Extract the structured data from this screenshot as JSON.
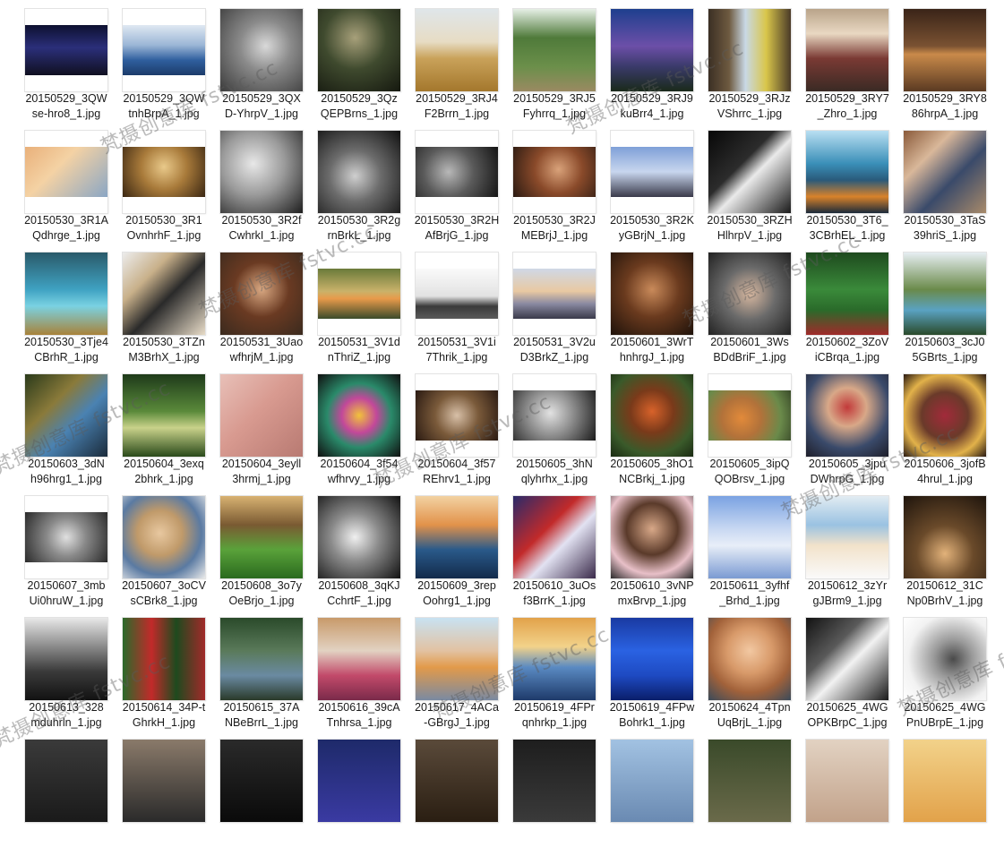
{
  "files": [
    {
      "name_line1": "20150529_3QW",
      "name_line2": "se-hro8_1.jpg",
      "thumb": {
        "fit": "landscape",
        "bg": "linear-gradient(180deg,#0d1030 0%,#2b2f7a 45%,#101020 100%)"
      }
    },
    {
      "name_line1": "20150529_3QW",
      "name_line2": "tnhBrpA_1.jpg",
      "thumb": {
        "fit": "landscape",
        "bg": "linear-gradient(180deg,#dfe8f2 0%,#9bb6d6 40%,#2f5f9e 70%,#1c3b6a 100%)"
      }
    },
    {
      "name_line1": "20150529_3QX",
      "name_line2": "D-YhrpV_1.jpg",
      "thumb": {
        "fit": "square",
        "bg": "radial-gradient(circle at 55% 45%,#d9d9d9 0%,#8a8a8a 40%,#3b3b3b 100%)"
      }
    },
    {
      "name_line1": "20150529_3Qz",
      "name_line2": "QEPBrns_1.jpg",
      "thumb": {
        "fit": "square",
        "bg": "radial-gradient(circle at 45% 35%,#a7a07a 0%,#3f4a2e 45%,#15180f 100%)"
      }
    },
    {
      "name_line1": "20150529_3RJ4",
      "name_line2": "F2Brrn_1.jpg",
      "thumb": {
        "fit": "square",
        "bg": "linear-gradient(180deg,#dfe6ea 0%,#e7dcc4 40%,#c9a25a 60%,#a4772c 100%)"
      }
    },
    {
      "name_line1": "20150529_3RJ5",
      "name_line2": "Fyhrrq_1.jpg",
      "thumb": {
        "fit": "square",
        "bg": "linear-gradient(180deg,#e6efe6 0%,#4f7a3a 35%,#6b8f4a 70%,#9a8a62 100%)"
      }
    },
    {
      "name_line1": "20150529_3RJ9",
      "name_line2": "kuBrr4_1.jpg",
      "thumb": {
        "fit": "square",
        "bg": "linear-gradient(180deg,#1e3f8e 0%,#6c4fa8 45%,#3a3a6a 70%,#1a2a1a 100%)"
      }
    },
    {
      "name_line1": "20150529_3RJz",
      "name_line2": "VShrrc_1.jpg",
      "thumb": {
        "fit": "square",
        "bg": "linear-gradient(90deg,#3b2f24 0%,#6e5a40 25%,#c9d9e6 45%,#d9c64a 70%,#4a3a28 100%)"
      }
    },
    {
      "name_line1": "20150529_3RY7",
      "name_line2": "_Zhro_1.jpg",
      "thumb": {
        "fit": "square",
        "bg": "linear-gradient(180deg,#b9a48a 0%,#e9d8c2 30%,#7a3a34 60%,#3a2a24 100%)"
      }
    },
    {
      "name_line1": "20150529_3RY8",
      "name_line2": "86hrpA_1.jpg",
      "thumb": {
        "fit": "square",
        "bg": "linear-gradient(180deg,#3a2418 0%,#7a5232 45%,#c98a4a 55%,#5a3a22 100%)"
      }
    },
    {
      "name_line1": "20150530_3R1A",
      "name_line2": "Qdhrge_1.jpg",
      "thumb": {
        "fit": "landscape",
        "bg": "linear-gradient(135deg,#e9b07a 0%,#f4d2a4 40%,#8aa6c4 100%)"
      }
    },
    {
      "name_line1": "20150530_3R1",
      "name_line2": "OvnhrhF_1.jpg",
      "thumb": {
        "fit": "landscape",
        "bg": "radial-gradient(circle at 50% 40%,#e9c98a 0%,#a87a3a 45%,#3a2612 100%)"
      }
    },
    {
      "name_line1": "20150530_3R2f",
      "name_line2": "CwhrkI_1.jpg",
      "thumb": {
        "fit": "square",
        "bg": "radial-gradient(circle at 40% 40%,#e8e8e8 0%,#9a9a9a 45%,#1e1e1e 100%)"
      }
    },
    {
      "name_line1": "20150530_3R2g",
      "name_line2": "rnBrkL_1.jpg",
      "thumb": {
        "fit": "square",
        "bg": "radial-gradient(circle at 45% 55%,#cfcfcf 0%,#6c6c6c 40%,#101010 100%)"
      }
    },
    {
      "name_line1": "20150530_3R2H",
      "name_line2": "AfBrjG_1.jpg",
      "thumb": {
        "fit": "landscape",
        "bg": "radial-gradient(circle at 40% 50%,#b8b8b8 0%,#5a5a5a 45%,#141414 100%)"
      }
    },
    {
      "name_line1": "20150530_3R2J",
      "name_line2": "MEBrjJ_1.jpg",
      "thumb": {
        "fit": "landscape",
        "bg": "radial-gradient(circle at 55% 45%,#d9a27a 0%,#8a4a2a 45%,#2a1a12 100%)"
      }
    },
    {
      "name_line1": "20150530_3R2K",
      "name_line2": "yGBrjN_1.jpg",
      "thumb": {
        "fit": "landscape",
        "bg": "linear-gradient(180deg,#7fa0d8 0%,#c8d6ee 50%,#3a3a4a 100%)"
      }
    },
    {
      "name_line1": "20150530_3RZH",
      "name_line2": "HlhrpV_1.jpg",
      "thumb": {
        "fit": "square",
        "bg": "linear-gradient(135deg,#080808 0%,#2c2c2c 40%,#eaeaea 55%,#1a1a1a 100%)"
      }
    },
    {
      "name_line1": "20150530_3T6_",
      "name_line2": "3CBrhEL_1.jpg",
      "thumb": {
        "fit": "square",
        "bg": "linear-gradient(180deg,#b9dff2 0%,#3a8fb8 40%,#2a5a7a 60%,#d8822a 80%,#1a2a3a 100%)"
      }
    },
    {
      "name_line1": "20150530_3TaS",
      "name_line2": "39hriS_1.jpg",
      "thumb": {
        "fit": "square",
        "bg": "linear-gradient(135deg,#8a5a3a 0%,#d9b89a 30%,#3a4a6a 60%,#a88a6a 100%)"
      }
    },
    {
      "name_line1": "20150530_3Tje4",
      "name_line2": "CBrhR_1.jpg",
      "thumb": {
        "fit": "square",
        "bg": "linear-gradient(180deg,#2a5a6a 0%,#3fa2c2 45%,#7ad2e2 65%,#a8823a 100%)"
      }
    },
    {
      "name_line1": "20150530_3TZn",
      "name_line2": "M3BrhX_1.jpg",
      "thumb": {
        "fit": "square",
        "bg": "linear-gradient(135deg,#ececec 0%,#c8b08a 30%,#2a2a2a 55%,#e8dcc8 100%)"
      }
    },
    {
      "name_line1": "20150531_3Uao",
      "name_line2": "wfhrjM_1.jpg",
      "thumb": {
        "fit": "square",
        "bg": "radial-gradient(circle at 50% 45%,#d9a882 0%,#6a3a22 45%,#3a2a1e 100%)"
      }
    },
    {
      "name_line1": "20150531_3V1d",
      "name_line2": "nThriZ_1.jpg",
      "thumb": {
        "fit": "landscape",
        "bg": "linear-gradient(180deg,#6a7a3a 0%,#c9b26a 45%,#e89a4a 60%,#3a4a2a 100%)"
      }
    },
    {
      "name_line1": "20150531_3V1i",
      "name_line2": "7Thrik_1.jpg",
      "thumb": {
        "fit": "landscape",
        "bg": "linear-gradient(180deg,#fafafa 0%,#e2e2e2 55%,#3a3a3a 75%,#5a5a5a 100%)"
      }
    },
    {
      "name_line1": "20150531_3V2u",
      "name_line2": "D3BrkZ_1.jpg",
      "thumb": {
        "fit": "landscape",
        "bg": "linear-gradient(180deg,#cfd8e6 0%,#e9c9a2 45%,#8a8aa2 70%,#3a3a4a 100%)"
      }
    },
    {
      "name_line1": "20150601_3WrT",
      "name_line2": "hnhrgJ_1.jpg",
      "thumb": {
        "fit": "square",
        "bg": "radial-gradient(circle at 50% 45%,#c98a5a 0%,#6a3a1e 45%,#1e120a 100%)"
      }
    },
    {
      "name_line1": "20150601_3Ws",
      "name_line2": "BDdBriF_1.jpg",
      "thumb": {
        "fit": "square",
        "bg": "radial-gradient(circle at 50% 50%,#d8b8a0 0%,#6a6a6a 45%,#222 100%)"
      }
    },
    {
      "name_line1": "20150602_3ZoV",
      "name_line2": "iCBrqa_1.jpg",
      "thumb": {
        "fit": "square",
        "bg": "linear-gradient(180deg,#1e4a1e 0%,#3a8a3a 45%,#2a6a2a 70%,#a02a2a 100%)"
      }
    },
    {
      "name_line1": "20150603_3cJ0",
      "name_line2": "5GBrts_1.jpg",
      "thumb": {
        "fit": "square",
        "bg": "linear-gradient(180deg,#e6eef2 0%,#6a8a4a 45%,#5aa2c2 70%,#2a4a2a 100%)"
      }
    },
    {
      "name_line1": "20150603_3dN",
      "name_line2": "h96hrg1_1.jpg",
      "thumb": {
        "fit": "square",
        "bg": "linear-gradient(135deg,#2a3a1a 0%,#8a7a3a 35%,#4a82b2 60%,#1a2a3a 100%)"
      }
    },
    {
      "name_line1": "20150604_3exq",
      "name_line2": "2bhrk_1.jpg",
      "thumb": {
        "fit": "square",
        "bg": "linear-gradient(180deg,#1e3a1a 0%,#5a8a3a 45%,#c9d28a 65%,#2a4a1a 100%)"
      }
    },
    {
      "name_line1": "20150604_3eyll",
      "name_line2": "3hrmj_1.jpg",
      "thumb": {
        "fit": "square",
        "bg": "linear-gradient(135deg,#e8c0b8 0%,#d89a90 45%,#b87a72 100%)"
      }
    },
    {
      "name_line1": "20150604_3f54",
      "name_line2": "wfhrvy_1.jpg",
      "thumb": {
        "fit": "square",
        "bg": "radial-gradient(circle at 50% 50%,#f2c23a 0%,#c2489a 30%,#2a8a6a 55%,#101010 100%)"
      }
    },
    {
      "name_line1": "20150604_3f57",
      "name_line2": "REhrv1_1.jpg",
      "thumb": {
        "fit": "landscape",
        "bg": "radial-gradient(circle at 50% 50%,#d8c0a8 0%,#7a5a3a 45%,#2a1a12 100%)"
      }
    },
    {
      "name_line1": "20150605_3hN",
      "name_line2": "qlyhrhx_1.jpg",
      "thumb": {
        "fit": "landscape",
        "bg": "radial-gradient(circle at 45% 45%,#e2e2e2 0%,#8a8a8a 45%,#1a1a1a 100%)"
      }
    },
    {
      "name_line1": "20150605_3hO1",
      "name_line2": "NCBrkj_1.jpg",
      "thumb": {
        "fit": "square",
        "bg": "radial-gradient(circle at 50% 45%,#d8622a 0%,#7a3a1a 35%,#3a5a2a 70%,#1a2a12 100%)"
      }
    },
    {
      "name_line1": "20150605_3ipQ",
      "name_line2": "QOBrsv_1.jpg",
      "thumb": {
        "fit": "landscape",
        "bg": "radial-gradient(circle at 40% 55%,#e28a3a 0%,#b2723a 35%,#6a8a4a 70%,#3a4a2a 100%)"
      }
    },
    {
      "name_line1": "20150605_3jpu",
      "name_line2": "DWhrpG_1.jpg",
      "thumb": {
        "fit": "square",
        "bg": "radial-gradient(circle at 50% 40%,#c23a3a 0%,#d8a888 30%,#3a4a6a 65%,#1e1e2a 100%)"
      }
    },
    {
      "name_line1": "20150606_3jofB",
      "name_line2": "4hrul_1.jpg",
      "thumb": {
        "fit": "square",
        "bg": "radial-gradient(circle at 50% 50%,#a22a3a 0%,#6a3a2a 40%,#e2b24a 70%,#2a1a12 100%)"
      }
    },
    {
      "name_line1": "20150607_3mb",
      "name_line2": "Ui0hruW_1.jpg",
      "thumb": {
        "fit": "landscape",
        "bg": "radial-gradient(circle at 50% 50%,#e0e0e0 0%,#8a8a8a 40%,#2a2a2a 100%)"
      }
    },
    {
      "name_line1": "20150607_3oCV",
      "name_line2": "sCBrk8_1.jpg",
      "thumb": {
        "fit": "square",
        "bg": "radial-gradient(circle at 45% 45%,#e8c8a0 0%,#c09a6a 35%,#5a7aa2 65%,#eaeaea 100%)"
      }
    },
    {
      "name_line1": "20150608_3o7y",
      "name_line2": "OeBrjo_1.jpg",
      "thumb": {
        "fit": "square",
        "bg": "linear-gradient(180deg,#d8b272 0%,#7a5a32 35%,#5aa23a 65%,#2a6a1e 100%)"
      }
    },
    {
      "name_line1": "20150608_3qKJ",
      "name_line2": "CchrtF_1.jpg",
      "thumb": {
        "fit": "square",
        "bg": "radial-gradient(circle at 45% 50%,#f0f0f0 0%,#8a8a8a 40%,#121212 100%)"
      }
    },
    {
      "name_line1": "20150609_3rep",
      "name_line2": "Oohrg1_1.jpg",
      "thumb": {
        "fit": "square",
        "bg": "linear-gradient(180deg,#f2d2a2 0%,#e2924a 35%,#2a5a8a 65%,#122a4a 100%)"
      }
    },
    {
      "name_line1": "20150610_3uOs",
      "name_line2": "f3BrrK_1.jpg",
      "thumb": {
        "fit": "square",
        "bg": "linear-gradient(135deg,#2a2a6a 0%,#c22a2a 40%,#e2e2f2 60%,#3a2a4a 100%)"
      }
    },
    {
      "name_line1": "20150610_3vNP",
      "name_line2": "mxBrvp_1.jpg",
      "thumb": {
        "fit": "square",
        "bg": "radial-gradient(circle at 50% 40%,#d8a888 0%,#5a3a2a 40%,#e8c0c8 70%,#2a2a2a 100%)"
      }
    },
    {
      "name_line1": "20150611_3yfhf",
      "name_line2": "_Brhd_1.jpg",
      "thumb": {
        "fit": "square",
        "bg": "linear-gradient(180deg,#7aa2e2 0%,#c8d8f2 40%,#e8eef8 60%,#7a9ad2 100%)"
      }
    },
    {
      "name_line1": "20150612_3zYr",
      "name_line2": "gJBrm9_1.jpg",
      "thumb": {
        "fit": "square",
        "bg": "linear-gradient(180deg,#e2ecf2 0%,#9ac2e2 35%,#f2e2ca 60%,#fafafa 100%)"
      }
    },
    {
      "name_line1": "20150612_31C",
      "name_line2": "Np0BrhV_1.jpg",
      "thumb": {
        "fit": "square",
        "bg": "radial-gradient(circle at 50% 70%,#e2b27a 0%,#6a4a2a 40%,#1e140c 100%)"
      }
    },
    {
      "name_line1": "20150613_328",
      "name_line2": "mduhrln_1.jpg",
      "thumb": {
        "fit": "square",
        "bg": "linear-gradient(180deg,#e8e8e8 0%,#8a8a8a 35%,#3a3a3a 65%,#121212 100%)"
      }
    },
    {
      "name_line1": "20150614_34P-t",
      "name_line2": "GhrkH_1.jpg",
      "thumb": {
        "fit": "square",
        "bg": "linear-gradient(90deg,#2a6a2a 0%,#c22a2a 35%,#1e4a1e 65%,#a22a2a 100%)"
      }
    },
    {
      "name_line1": "20150615_37A",
      "name_line2": "NBeBrrL_1.jpg",
      "thumb": {
        "fit": "square",
        "bg": "linear-gradient(180deg,#2a4a2a 0%,#5a7a5a 40%,#6a8aa2 70%,#2a3a2a 100%)"
      }
    },
    {
      "name_line1": "20150616_39cA",
      "name_line2": "Tnhrsa_1.jpg",
      "thumb": {
        "fit": "square",
        "bg": "linear-gradient(180deg,#c89a6a 0%,#e2d2c2 40%,#c24a6a 70%,#7a2a4a 100%)"
      }
    },
    {
      "name_line1": "20150617_4ACa",
      "name_line2": "-GBrgJ_1.jpg",
      "thumb": {
        "fit": "square",
        "bg": "linear-gradient(180deg,#c8e2f2 0%,#e2c2a2 40%,#e29a4a 60%,#7a8aa2 100%)"
      }
    },
    {
      "name_line1": "20150619_4FPr",
      "name_line2": "qnhrkp_1.jpg",
      "thumb": {
        "fit": "square",
        "bg": "linear-gradient(180deg,#e2a24a 0%,#f2d28a 35%,#5a8ac2 60%,#1e3a6a 100%)"
      }
    },
    {
      "name_line1": "20150619_4FPw",
      "name_line2": "Bohrk1_1.jpg",
      "thumb": {
        "fit": "square",
        "bg": "linear-gradient(180deg,#1a3aa2 0%,#2a62e2 40%,#1e4ac2 70%,#0a1e6a 100%)"
      }
    },
    {
      "name_line1": "20150624_4Tpn",
      "name_line2": "UqBrjL_1.jpg",
      "thumb": {
        "fit": "square",
        "bg": "radial-gradient(circle at 50% 40%,#f2c8a2 0%,#d89a6a 35%,#a2623a 65%,#3a4a5a 100%)"
      }
    },
    {
      "name_line1": "20150625_4WG",
      "name_line2": "OPKBrpC_1.jpg",
      "thumb": {
        "fit": "square",
        "bg": "linear-gradient(135deg,#121212 0%,#5a5a5a 35%,#f2f2f2 55%,#1a1a1a 100%)"
      }
    },
    {
      "name_line1": "20150625_4WG",
      "name_line2": "PnUBrpE_1.jpg",
      "thumb": {
        "fit": "square",
        "bg": "radial-gradient(circle at 60% 50%,#4a4a4a 0%,#9a9a9a 30%,#f2f2f2 70%,#ffffff 100%)"
      }
    },
    {
      "name_line1": "",
      "name_line2": "",
      "thumb": {
        "fit": "square",
        "bg": "linear-gradient(180deg,#3a3a3a 0%,#1a1a1a 100%)"
      }
    },
    {
      "name_line1": "",
      "name_line2": "",
      "thumb": {
        "fit": "square",
        "bg": "linear-gradient(180deg,#8a7a6a 0%,#2a2a2a 100%)"
      }
    },
    {
      "name_line1": "",
      "name_line2": "",
      "thumb": {
        "fit": "square",
        "bg": "linear-gradient(180deg,#2a2a2a 0%,#0a0a0a 100%)"
      }
    },
    {
      "name_line1": "",
      "name_line2": "",
      "thumb": {
        "fit": "square",
        "bg": "linear-gradient(180deg,#1e2a6a 0%,#3a3aa2 100%)"
      }
    },
    {
      "name_line1": "",
      "name_line2": "",
      "thumb": {
        "fit": "square",
        "bg": "linear-gradient(180deg,#5a4a3a 0%,#2a1e12 100%)"
      }
    },
    {
      "name_line1": "",
      "name_line2": "",
      "thumb": {
        "fit": "square",
        "bg": "linear-gradient(180deg,#1e1e1e 0%,#3a3a3a 100%)"
      }
    },
    {
      "name_line1": "",
      "name_line2": "",
      "thumb": {
        "fit": "square",
        "bg": "linear-gradient(180deg,#a2c2e2 0%,#6a8ab2 100%)"
      }
    },
    {
      "name_line1": "",
      "name_line2": "",
      "thumb": {
        "fit": "square",
        "bg": "linear-gradient(180deg,#3a4a2a 0%,#6a6a4a 100%)"
      }
    },
    {
      "name_line1": "",
      "name_line2": "",
      "thumb": {
        "fit": "square",
        "bg": "linear-gradient(180deg,#e2d2c2 0%,#c2a28a 100%)"
      }
    },
    {
      "name_line1": "",
      "name_line2": "",
      "thumb": {
        "fit": "square",
        "bg": "linear-gradient(180deg,#f2d28a 0%,#e2a24a 100%)"
      }
    }
  ],
  "watermark": {
    "texts": [
      "梵摄创意库 fstvc.cc",
      "梵摄创意库 fstvc.cc",
      "梵摄创意库 fstvc.cc",
      "梵摄创意库 fstvc.cc",
      "梵摄创意库 fstvc.cc",
      "梵摄创意库 fstvc.cc",
      "梵摄创意库 fstvc.cc",
      "梵摄创意库 fstvc.cc",
      "梵摄创意库 fstvc.cc",
      "梵摄创意库 fstvc.cc"
    ]
  }
}
